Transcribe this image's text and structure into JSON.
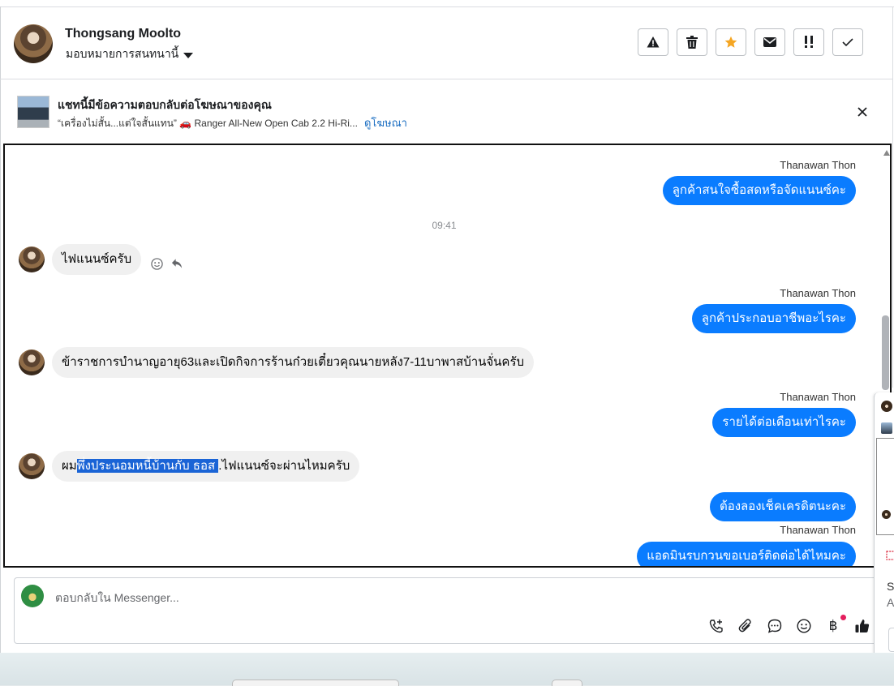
{
  "header": {
    "customer_name": "Thongsang Moolto",
    "assign_label": "มอบหมายการสนทนานี้",
    "actions": [
      {
        "name": "report-button",
        "icon": "warning-icon"
      },
      {
        "name": "delete-button",
        "icon": "trash-icon"
      },
      {
        "name": "star-button",
        "icon": "star-icon"
      },
      {
        "name": "mark-unread-button",
        "icon": "mail-icon"
      },
      {
        "name": "follow-up-button",
        "icon": "double-exclamation-icon"
      },
      {
        "name": "mark-done-button",
        "icon": "check-icon"
      }
    ]
  },
  "ad_banner": {
    "title": "แชทนี้มีข้อความตอบกลับต่อโฆษณาของคุณ",
    "ad_text": "“เครื่องไม่สั้น...แต่ใจสั้นแทน” 🚗 Ranger All-New Open Cab 2.2 Hi-Ri...",
    "view_ad_link": "ดูโฆษณา"
  },
  "messages": {
    "m1_sender": "Thanawan Thon",
    "m1_text": "ลูกค้าสนใจซื้อสดหรือจัดแนนซ์คะ",
    "time": "09:41",
    "m2_text": "ไฟแนนซ์ครับ",
    "m3_sender": "Thanawan Thon",
    "m3_text": "ลูกค้าประกอบอาชีพอะไรคะ",
    "m4_text": "ข้าราชการบำนาญอายุ63และเปิดกิจการร้านก๋วยเตี๋ยวคุณนายหลัง7-11บาพาสบ้านจั่นครับ",
    "m5_sender": "Thanawan Thon",
    "m5_text": "รายได้ต่อเดือนเท่าไรคะ",
    "m6_prefix": "ผม",
    "m6_highlight": "พึ่งประนอมหนี้บ้านกับ ธอส ",
    "m6_suffix": ".ไฟแนนซ์จะผ่านไหมครับ",
    "m7_text": "ต้องลองเช็คเครดิตนะคะ",
    "m8_sender": "Thanawan Thon",
    "m8_text": "แอดมินรบกวนขอเบอร์ติดต่อได้ไหมคะ"
  },
  "composer": {
    "placeholder": "ตอบกลับใน Messenger...",
    "baht_symbol": "฿",
    "icons": [
      "phone-plus-icon",
      "attach-icon",
      "chat-bubble-icon",
      "emoji-icon",
      "baht-icon",
      "like-icon"
    ]
  },
  "popup": {
    "text_1": "S",
    "text_2": "A"
  },
  "colors": {
    "outgoing_bubble": "#0a7cff",
    "incoming_bubble": "#f0f0f0",
    "star": "#f5a623",
    "link": "#1b6ec2"
  }
}
